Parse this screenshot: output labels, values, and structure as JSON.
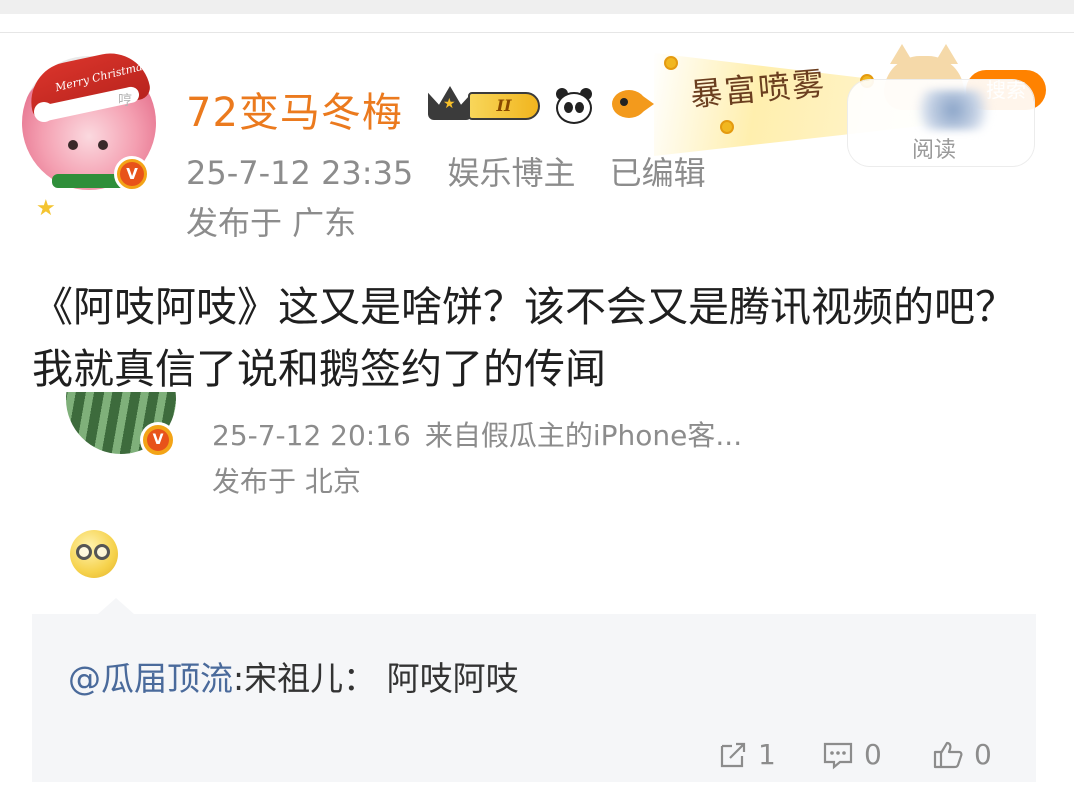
{
  "post": {
    "avatar_hat_text": "Merry Christmas",
    "avatar_hum": "哼",
    "avatar_badge": "V",
    "username": "72变马冬梅",
    "level_badge": "II",
    "timestamp": "25-7-12 23:35",
    "category": "娱乐博主",
    "edited": "已编辑",
    "location": "发布于 广东",
    "content": "《阿吱阿吱》这又是啥饼？该不会又是腾讯视频的吧？ 我就真信了说和鹅签约了的传闻"
  },
  "promo": {
    "text": "暴富喷雾",
    "follow_label": "搜索",
    "blur_label": "阅读"
  },
  "retweet": {
    "badge": "V",
    "timestamp": "25-7-12 20:16",
    "source": "来自假瓜主的iPhone客...",
    "location": "发布于 北京"
  },
  "repost": {
    "mention": "@瓜届顶流",
    "text": ":宋祖儿：  阿吱阿吱"
  },
  "actions": {
    "share_count": "1",
    "comment_count": "0",
    "like_count": "0"
  },
  "colors": {
    "username": "#eb7a1e",
    "meta": "#8c8c8c",
    "mention": "#4a6a9b",
    "repost_bg": "#f5f6f8"
  }
}
